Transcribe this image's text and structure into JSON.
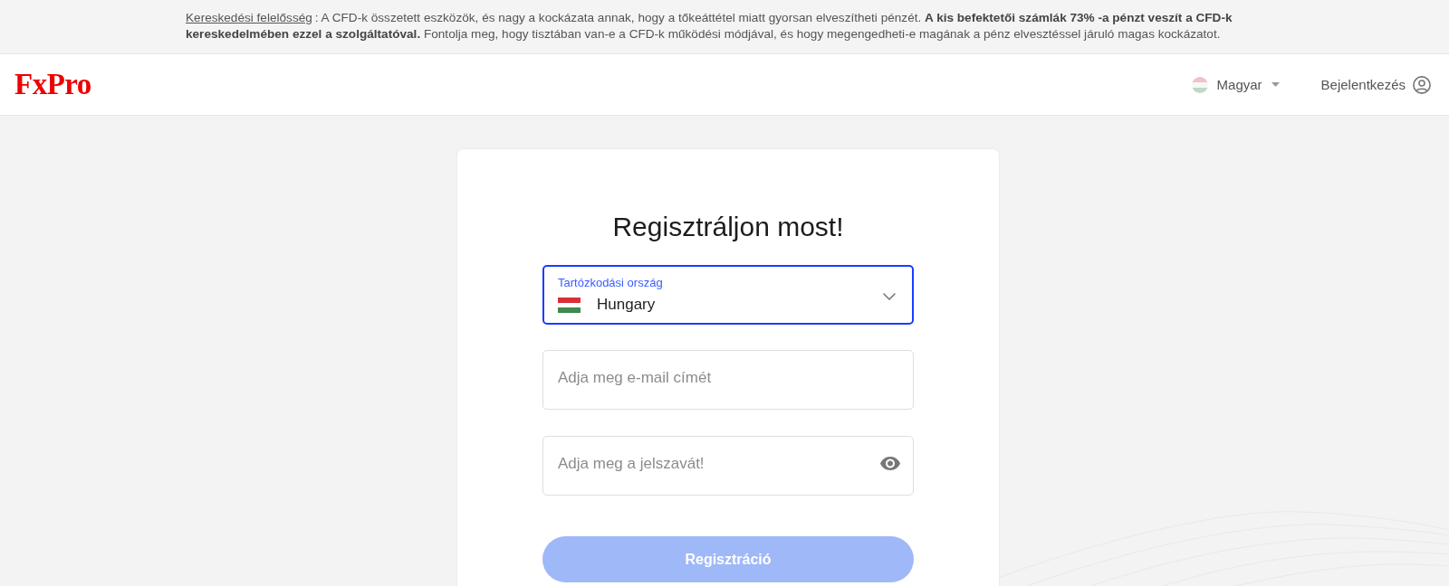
{
  "disclaimer": {
    "link": "Kereskedési felelősség",
    "text": ": A CFD-k összetett eszközök, és nagy a kockázata annak, hogy a tőkeáttétel miatt gyorsan elveszítheti pénzét. **A kis befektetői számlák 73% -a pénzt veszít a CFD-k kereskedelmében ezzel a szolgáltatóval.** Fontolja meg, hogy tisztában van-e a CFD-k működési módjával, és hogy megengedheti-e magának a pénz elvesztéssel járuló magas kockázatot."
  },
  "header": {
    "logo": "FxPro",
    "language": "Magyar",
    "login": "Bejelentkezés"
  },
  "form": {
    "title": "Regisztráljon most!",
    "fields": [
      {
        "kind": "select",
        "label": "Tartózkodási ország",
        "value": "Hungary",
        "focused": true
      },
      {
        "kind": "email",
        "placeholder": "Adja meg e-mail címét",
        "focused": false
      },
      {
        "kind": "password",
        "placeholder": "Adja meg a jelszavát!",
        "focused": false
      }
    ],
    "submit": {
      "label": "Regisztráció",
      "disabled": true
    }
  }
}
